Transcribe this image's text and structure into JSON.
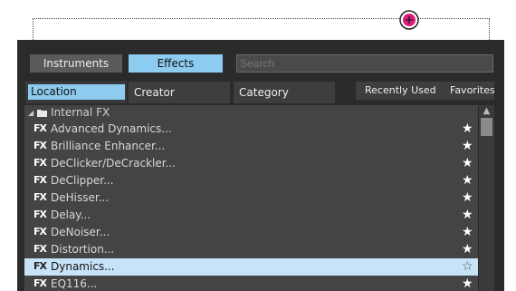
{
  "tabs": {
    "instruments": "Instruments",
    "effects": "Effects"
  },
  "search": {
    "placeholder": "Search"
  },
  "source_tabs": {
    "location": "Location",
    "creator": "Creator",
    "category": "Category",
    "recently_used": "Recently Used",
    "favorites": "Favorites"
  },
  "group": {
    "label": "Internal FX",
    "icon": "folder-icon"
  },
  "items": [
    {
      "label": "Advanced Dynamics...",
      "favorite": true
    },
    {
      "label": "Brilliance Enhancer...",
      "favorite": true
    },
    {
      "label": "DeClicker/DeCrackler...",
      "favorite": true
    },
    {
      "label": "DeClipper...",
      "favorite": true
    },
    {
      "label": "DeHisser...",
      "favorite": true
    },
    {
      "label": "Delay...",
      "favorite": true
    },
    {
      "label": "DeNoiser...",
      "favorite": true
    },
    {
      "label": "Distortion...",
      "favorite": true
    },
    {
      "label": "Dynamics...",
      "favorite": false,
      "selected": true
    },
    {
      "label": "EQ116...",
      "favorite": true
    }
  ],
  "fx_badge": "FX",
  "star_filled": "★",
  "star_empty": "☆",
  "scroll_up": "▲",
  "expand": "◢",
  "colors": {
    "accent": "#8ecbf0",
    "panel": "#2b2b2b",
    "list": "#444444",
    "selected_row": "#c7e3f7",
    "cursor": "#e0197a"
  }
}
